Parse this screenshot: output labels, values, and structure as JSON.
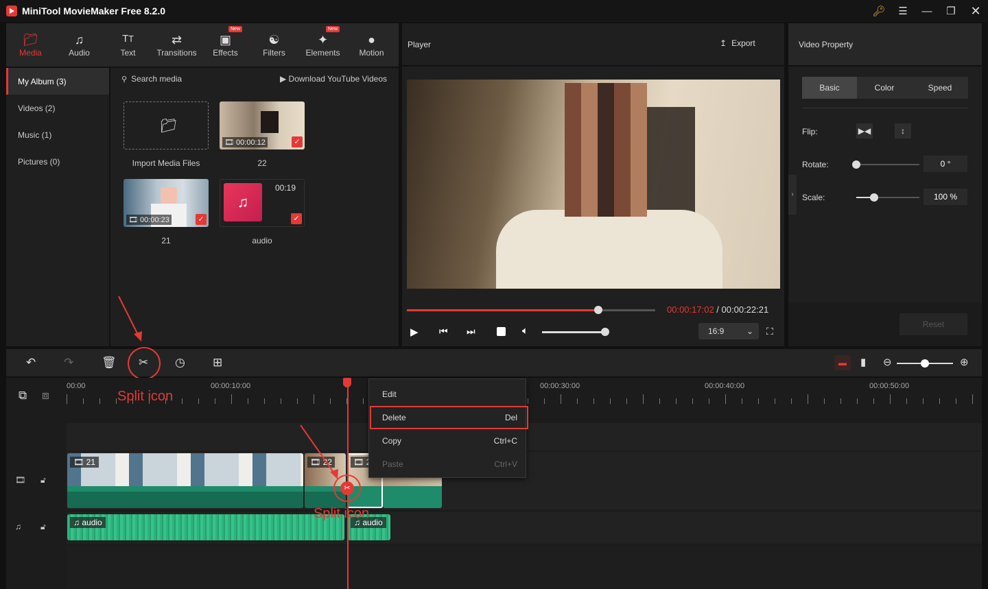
{
  "app": {
    "title": "MiniTool MovieMaker Free 8.2.0"
  },
  "window_controls": [
    "key-icon",
    "menu-icon",
    "minimize-icon",
    "maximize-icon",
    "close-icon"
  ],
  "tabs": [
    {
      "label": "Media",
      "icon": "media-icon",
      "active": true,
      "new": false
    },
    {
      "label": "Audio",
      "icon": "audio-icon",
      "active": false,
      "new": false
    },
    {
      "label": "Text",
      "icon": "text-icon",
      "active": false,
      "new": false
    },
    {
      "label": "Transitions",
      "icon": "transitions-icon",
      "active": false,
      "new": false
    },
    {
      "label": "Effects",
      "icon": "effects-icon",
      "active": false,
      "new": true
    },
    {
      "label": "Filters",
      "icon": "filters-icon",
      "active": false,
      "new": false
    },
    {
      "label": "Elements",
      "icon": "elements-icon",
      "active": false,
      "new": true
    },
    {
      "label": "Motion",
      "icon": "motion-icon",
      "active": false,
      "new": false
    }
  ],
  "new_badge": "New",
  "sidebar": {
    "items": [
      {
        "label": "My Album (3)",
        "active": true
      },
      {
        "label": "Videos (2)",
        "active": false
      },
      {
        "label": "Music (1)",
        "active": false
      },
      {
        "label": "Pictures (0)",
        "active": false
      }
    ]
  },
  "media": {
    "search_placeholder": "Search media",
    "download_label": "Download YouTube Videos",
    "items": [
      {
        "label": "Import Media Files",
        "type": "import"
      },
      {
        "label": "22",
        "type": "video",
        "duration": "00:00:12"
      },
      {
        "label": "21",
        "type": "video",
        "duration": "00:00:23"
      },
      {
        "label": "audio",
        "type": "audio",
        "duration": "00:19"
      }
    ]
  },
  "player": {
    "title": "Player",
    "export_label": "Export",
    "current_time": "00:00:17:02",
    "separator": " / ",
    "total_time": "00:00:22:21",
    "progress": 0.77,
    "volume": 0.98,
    "aspect_ratio": "16:9"
  },
  "video_property": {
    "title": "Video Property",
    "tabs": [
      "Basic",
      "Color",
      "Speed"
    ],
    "active_tab": "Basic",
    "flip_label": "Flip:",
    "rotate_label": "Rotate:",
    "rotate_value": "0 °",
    "rotate_fraction": 0.0,
    "scale_label": "Scale:",
    "scale_value": "100 %",
    "scale_fraction": 0.28,
    "reset_label": "Reset"
  },
  "toolbar": {
    "icons": [
      "undo-icon",
      "redo-icon",
      "delete-icon",
      "split-icon",
      "speed-icon",
      "crop-icon"
    ],
    "zoom_fraction": 0.5
  },
  "timeline": {
    "ruler_labels": [
      "00:00",
      "00:00:10:00",
      "00:00:30:00",
      "00:00:40:00",
      "00:00:50:00"
    ],
    "video_clips": [
      {
        "label": "21"
      },
      {
        "label": "22"
      },
      {
        "label": "2"
      }
    ],
    "audio_clips": [
      {
        "label": "audio"
      },
      {
        "label": "audio"
      }
    ]
  },
  "context_menu": {
    "items": [
      {
        "label": "Edit",
        "shortcut": "",
        "disabled": false
      },
      {
        "label": "Delete",
        "shortcut": "Del",
        "disabled": false,
        "highlighted": true
      },
      {
        "label": "Copy",
        "shortcut": "Ctrl+C",
        "disabled": false
      },
      {
        "label": "Paste",
        "shortcut": "Ctrl+V",
        "disabled": true
      }
    ]
  },
  "annotations": {
    "split_icon_top": "Split icon",
    "split_icon_bottom": "Split icon"
  },
  "colors": {
    "accent": "#e53935",
    "clip_green": "#1e8c6a",
    "audio_green": "#2fb37e"
  }
}
